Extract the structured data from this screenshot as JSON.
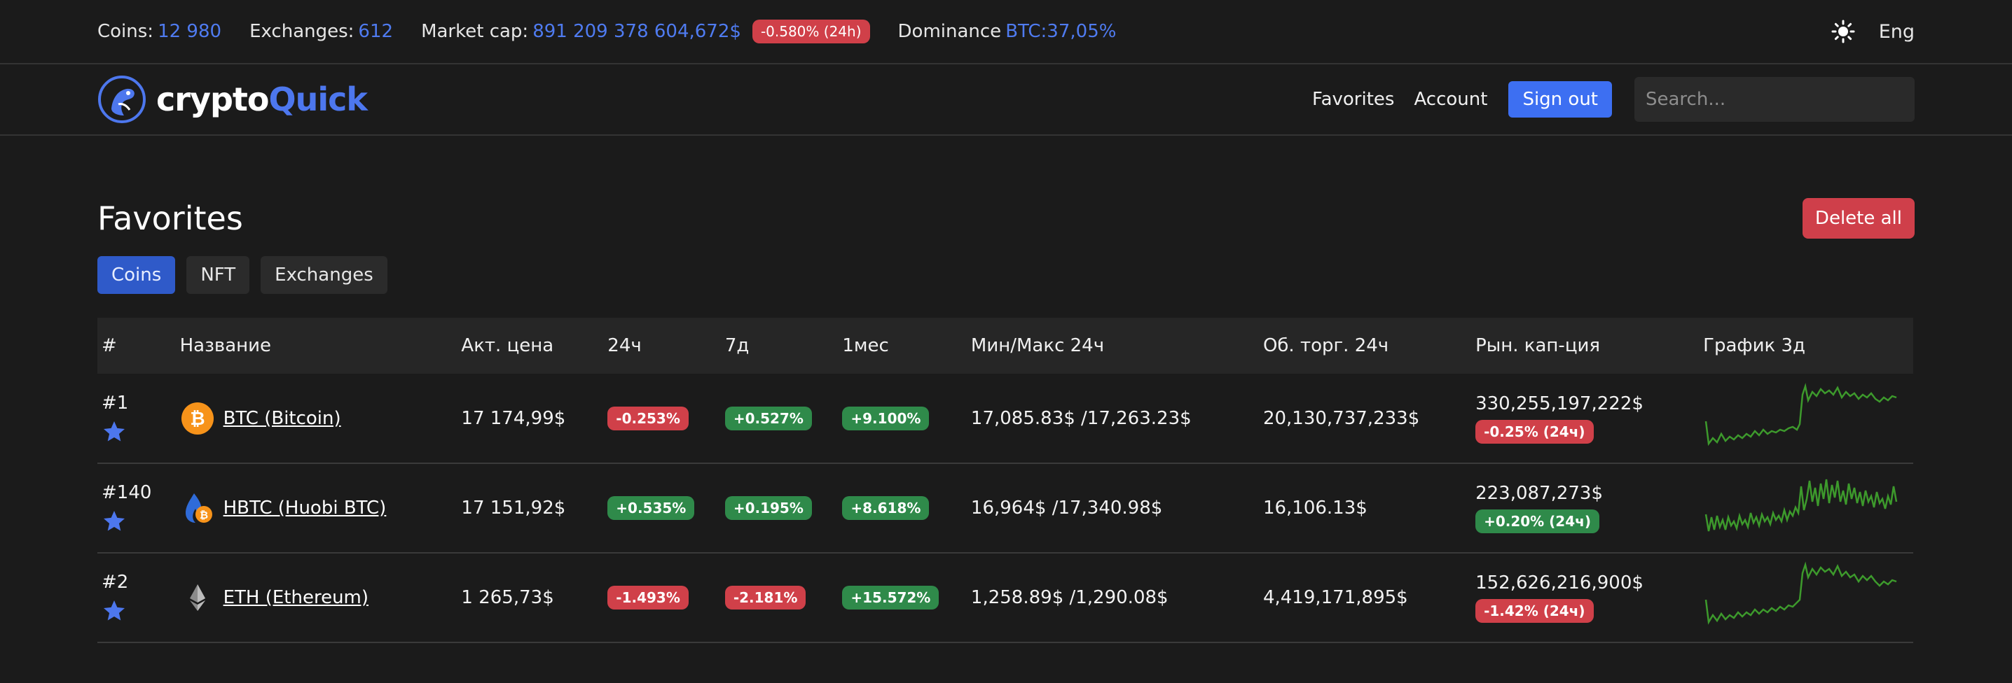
{
  "topbar": {
    "coins_label": "Coins:",
    "coins_value": "12 980",
    "exchanges_label": "Exchanges:",
    "exchanges_value": "612",
    "marketcap_label": "Market cap:",
    "marketcap_value": "891 209 378 604,672$",
    "marketcap_change": "-0.580% (24h)",
    "dominance_label": "Dominance",
    "dominance_value": "BTC:37,05%",
    "theme_icon": "sun-icon",
    "language": "Eng"
  },
  "navbar": {
    "brand_part1": "crypto",
    "brand_part2": "Quick",
    "favorites": "Favorites",
    "account": "Account",
    "sign_out": "Sign out",
    "search_placeholder": "Search..."
  },
  "main": {
    "title": "Favorites",
    "delete_all": "Delete all",
    "tabs": [
      {
        "label": "Coins",
        "active": true
      },
      {
        "label": "NFT",
        "active": false
      },
      {
        "label": "Exchanges",
        "active": false
      }
    ]
  },
  "table": {
    "headers": [
      "#",
      "Название",
      "Акт. цена",
      "24ч",
      "7д",
      "1мес",
      "Мин/Макс 24ч",
      "Об. торг. 24ч",
      "Рын. кап-ция",
      "График 3д"
    ],
    "rows": [
      {
        "rank": "#1",
        "icon": "bitcoin-icon",
        "name": "BTC (Bitcoin)",
        "price": "17 174,99$",
        "ch24": "-0.253%",
        "ch24_dir": "down",
        "ch7": "+0.527%",
        "ch7_dir": "up",
        "ch30": "+9.100%",
        "ch30_dir": "up",
        "minmax": "17,085.83$ /17,263.23$",
        "volume": "20,130,737,233$",
        "mcap": "330,255,197,222$",
        "mcap_change": "-0.25% (24ч)",
        "mcap_dir": "down"
      },
      {
        "rank": "#140",
        "icon": "huobi-btc-icon",
        "name": "HBTC (Huobi BTC)",
        "price": "17 151,92$",
        "ch24": "+0.535%",
        "ch24_dir": "up",
        "ch7": "+0.195%",
        "ch7_dir": "up",
        "ch30": "+8.618%",
        "ch30_dir": "up",
        "minmax": "16,964$ /17,340.98$",
        "volume": "16,106.13$",
        "mcap": "223,087,273$",
        "mcap_change": "+0.20% (24ч)",
        "mcap_dir": "up"
      },
      {
        "rank": "#2",
        "icon": "ethereum-icon",
        "name": "ETH (Ethereum)",
        "price": "1 265,73$",
        "ch24": "-1.493%",
        "ch24_dir": "down",
        "ch7": "-2.181%",
        "ch7_dir": "down",
        "ch30": "+15.572%",
        "ch30_dir": "up",
        "minmax": "1,258.89$ /1,290.08$",
        "volume": "4,419,171,895$",
        "mcap": "152,626,216,900$",
        "mcap_change": "-1.42% (24ч)",
        "mcap_dir": "down"
      }
    ]
  },
  "colors": {
    "accent": "#3d6ff2",
    "link_value": "#4f7bf0",
    "danger": "#d04049",
    "success": "#2f8a4a",
    "sparkline": "#3d9a2c"
  }
}
